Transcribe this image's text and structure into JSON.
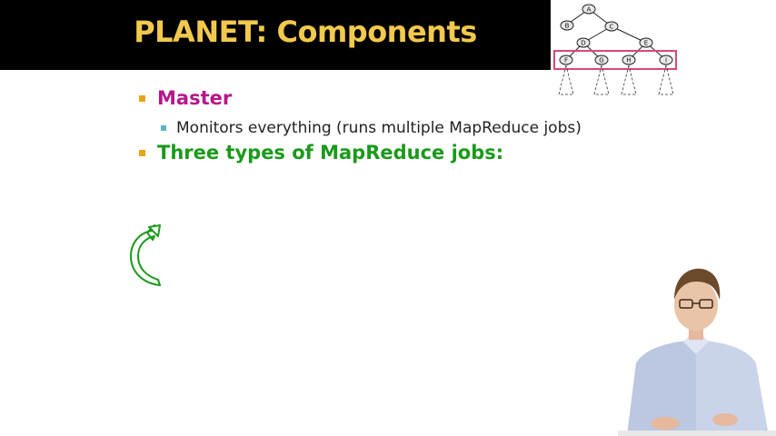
{
  "slide": {
    "title": "PLANET: Components",
    "title_color": "#f2c94c",
    "bullets": [
      {
        "text": "Master",
        "color": "#b5178a",
        "bullet_color": "#e8a317"
      },
      {
        "text": "Monitors everything (runs multiple MapReduce jobs)",
        "bullet_color": "#5bb5c8"
      },
      {
        "text": "Three types of MapReduce jobs:",
        "color": "#1a9a1a",
        "bullet_color": "#e8a317"
      }
    ]
  },
  "tree_diagram": {
    "nodes": [
      "A",
      "B",
      "C",
      "D",
      "E",
      "F",
      "G",
      "H",
      "I"
    ],
    "highlight_color": "#d9477a"
  },
  "icons": {
    "loop": "circular-arrow-icon",
    "loop_color": "#1a9a1a"
  }
}
